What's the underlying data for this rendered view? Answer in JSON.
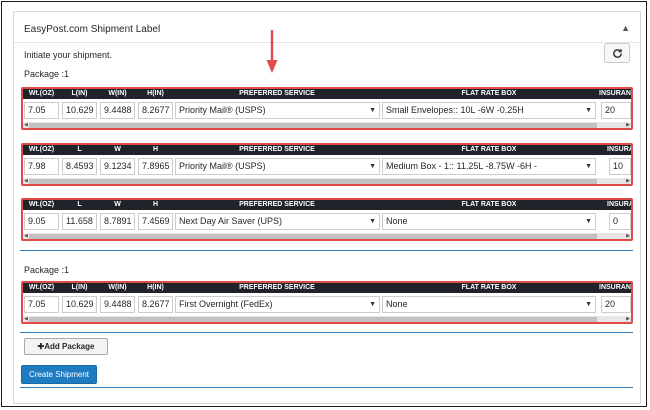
{
  "panel": {
    "title": "EasyPost.com Shipment Label",
    "toggle_icon": "triangle-up-icon",
    "initiate_text": "Initiate your shipment.",
    "refresh_icon": "refresh-icon"
  },
  "groups": [
    {
      "label": "Package :1"
    },
    {
      "label": "Package :1"
    }
  ],
  "packages": [
    {
      "headers": [
        "Wt.(OZ)",
        "L(IN)",
        "W(IN)",
        "H(IN)",
        "PREFERRED SERVICE",
        "FLAT RATE BOX",
        "INSURAN"
      ],
      "weight": "7.05",
      "length": "10.629",
      "width": "9.4488",
      "height": "8.2677",
      "service": "Priority Mail® (USPS)",
      "flat_rate_box": "Small Envelopes:: 10L -6W -0.25H",
      "insurance": "20"
    },
    {
      "headers": [
        "Wt.(OZ)",
        "L",
        "W",
        "H",
        "PREFERRED SERVICE",
        "FLAT RATE BOX",
        "INSURA"
      ],
      "weight": "7.98",
      "length": "8.4593",
      "width": "9.1234",
      "height": "7.8965",
      "service": "Priority Mail® (USPS)",
      "flat_rate_box": "Medium Box - 1:: 11.25L -8.75W -6H -",
      "insurance": "10"
    },
    {
      "headers": [
        "Wt.(OZ)",
        "L",
        "W",
        "H",
        "PREFERRED SERVICE",
        "FLAT RATE BOX",
        "INSURA"
      ],
      "weight": "9.05",
      "length": "11.658",
      "width": "8.7891",
      "height": "7.4569",
      "service": "Next Day Air Saver (UPS)",
      "flat_rate_box": "None",
      "insurance": "0"
    },
    {
      "headers": [
        "Wt.(OZ)",
        "L(IN)",
        "W(IN)",
        "H(IN)",
        "PREFERRED SERVICE",
        "FLAT RATE BOX",
        "INSURAN"
      ],
      "weight": "7.05",
      "length": "10.629",
      "width": "9.4488",
      "height": "8.2677",
      "service": "First Overnight (FedEx)",
      "flat_rate_box": "None",
      "insurance": "20"
    }
  ],
  "buttons": {
    "add_package": "✚Add Package",
    "create_shipment": "Create Shipment"
  },
  "colors": {
    "highlight_border": "#e04a4a",
    "header_bg": "#20232a",
    "accent_blue": "#1f7bbf",
    "annotation_arrow": "#e04a4a"
  }
}
